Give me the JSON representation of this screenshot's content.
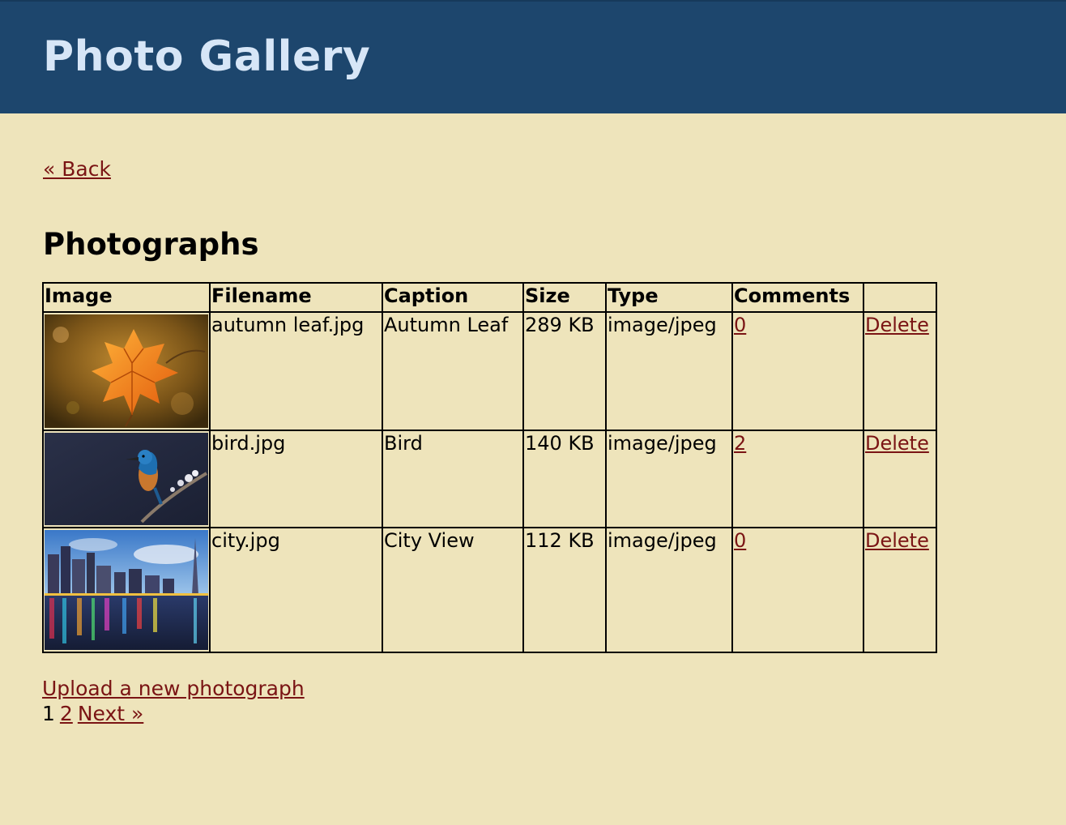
{
  "header": {
    "title": "Photo Gallery"
  },
  "nav": {
    "back_label": "« Back"
  },
  "section_title": "Photographs",
  "table": {
    "headers": [
      "Image",
      "Filename",
      "Caption",
      "Size",
      "Type",
      "Comments",
      ""
    ],
    "rows": [
      {
        "image": "autumn-leaf-thumbnail",
        "filename": "autumn leaf.jpg",
        "caption": "Autumn Leaf",
        "size": "289 KB",
        "type": "image/jpeg",
        "comments": "0",
        "delete_label": "Delete"
      },
      {
        "image": "bird-thumbnail",
        "filename": "bird.jpg",
        "caption": "Bird",
        "size": "140 KB",
        "type": "image/jpeg",
        "comments": "2",
        "delete_label": "Delete"
      },
      {
        "image": "city-thumbnail",
        "filename": "city.jpg",
        "caption": "City View",
        "size": "112 KB",
        "type": "image/jpeg",
        "comments": "0",
        "delete_label": "Delete"
      }
    ]
  },
  "footer": {
    "upload_label": "Upload a new photograph",
    "pagination": {
      "current": "1",
      "page_2": "2",
      "next_label": "Next »"
    }
  },
  "colors": {
    "header_bg": "#1d466d",
    "page_bg": "#eee4bb",
    "link": "#7a1414",
    "title": "#d7e6f7"
  }
}
